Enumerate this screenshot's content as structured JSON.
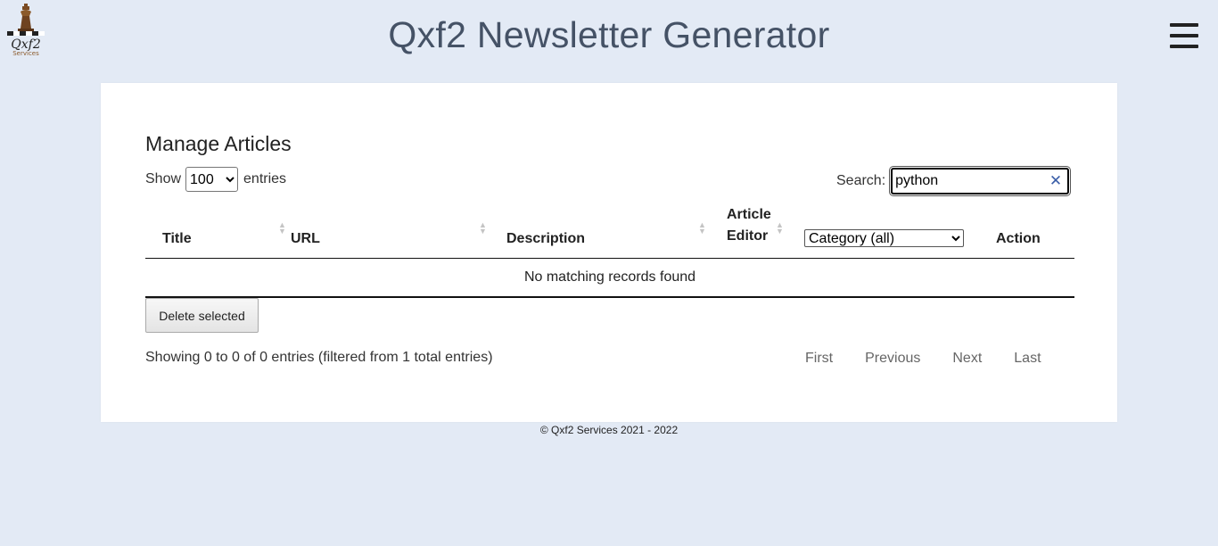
{
  "header": {
    "logo_text": "Qxf2",
    "logo_sub": "Services",
    "title": "Qxf2 Newsletter Generator",
    "menu_icon": "hamburger-icon"
  },
  "main": {
    "heading": "Manage Articles",
    "show_label": "Show",
    "entries_label": "entries",
    "page_length": "100",
    "search_label": "Search:",
    "search_value": "python",
    "clear_icon": "close-icon",
    "columns": [
      "Title",
      "URL",
      "Description",
      "Article",
      "Editor",
      "Action"
    ],
    "category_filter": "Category (all)",
    "empty_message": "No matching records found",
    "delete_label": "Delete selected",
    "info": "Showing 0 to 0 of 0 entries (filtered from 1 total entries)",
    "pagination": [
      "First",
      "Previous",
      "Next",
      "Last"
    ]
  },
  "footer": {
    "text": "© Qxf2 Services 2021 - 2022"
  },
  "colors": {
    "background": "#e3eaf5",
    "title": "#455266",
    "clear_icon": "#3a5ea8"
  }
}
